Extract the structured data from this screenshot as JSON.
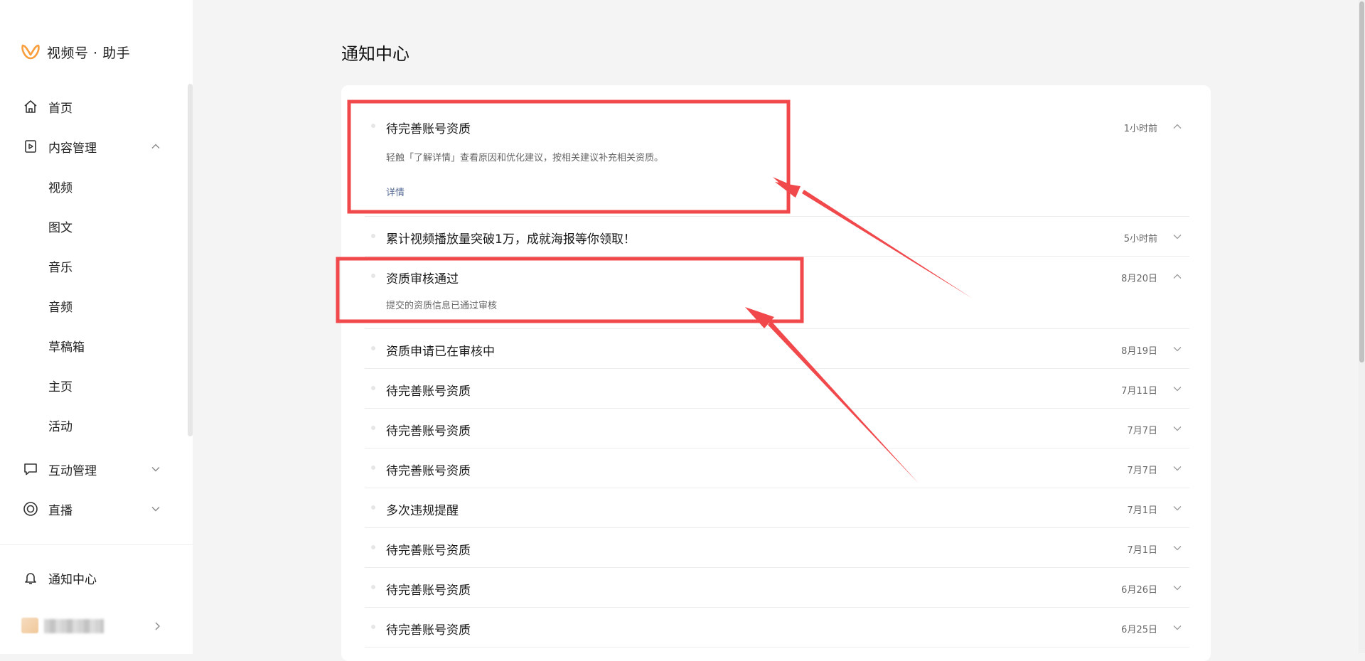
{
  "app": {
    "brand_name": "视频号 · 助手",
    "brand_color": "#fa9d3b"
  },
  "sidebar": {
    "items": [
      {
        "label": "首页",
        "icon": "home-icon"
      },
      {
        "label": "内容管理",
        "icon": "play-square-icon",
        "expanded": true
      },
      {
        "label": "互动管理",
        "icon": "comment-icon",
        "expanded": false
      },
      {
        "label": "直播",
        "icon": "live-icon",
        "expanded": false
      }
    ],
    "sub_items": [
      "视频",
      "图文",
      "音乐",
      "音频",
      "草稿箱",
      "主页",
      "活动"
    ],
    "notification_label": "通知中心"
  },
  "main": {
    "title": "通知中心",
    "link_color": "#576b95",
    "notifications": [
      {
        "title": "待完善账号资质",
        "time": "1小时前",
        "expanded": true,
        "desc": "轻触「了解详情」查看原因和优化建议，按相关建议补充相关资质。",
        "link": "详情"
      },
      {
        "title": "累计视频播放量突破1万，成就海报等你领取！",
        "time": "5小时前",
        "expanded": false
      },
      {
        "title": "资质审核通过",
        "time": "8月20日",
        "expanded": true,
        "desc": "提交的资质信息已通过审核"
      },
      {
        "title": "资质申请已在审核中",
        "time": "8月19日",
        "expanded": false
      },
      {
        "title": "待完善账号资质",
        "time": "7月11日",
        "expanded": false
      },
      {
        "title": "待完善账号资质",
        "time": "7月7日",
        "expanded": false
      },
      {
        "title": "待完善账号资质",
        "time": "7月7日",
        "expanded": false
      },
      {
        "title": "多次违规提醒",
        "time": "7月1日",
        "expanded": false
      },
      {
        "title": "待完善账号资质",
        "time": "7月1日",
        "expanded": false
      },
      {
        "title": "待完善账号资质",
        "time": "6月26日",
        "expanded": false
      },
      {
        "title": "待完善账号资质",
        "time": "6月25日",
        "expanded": false
      }
    ]
  },
  "annotation_color": "#f0484b"
}
